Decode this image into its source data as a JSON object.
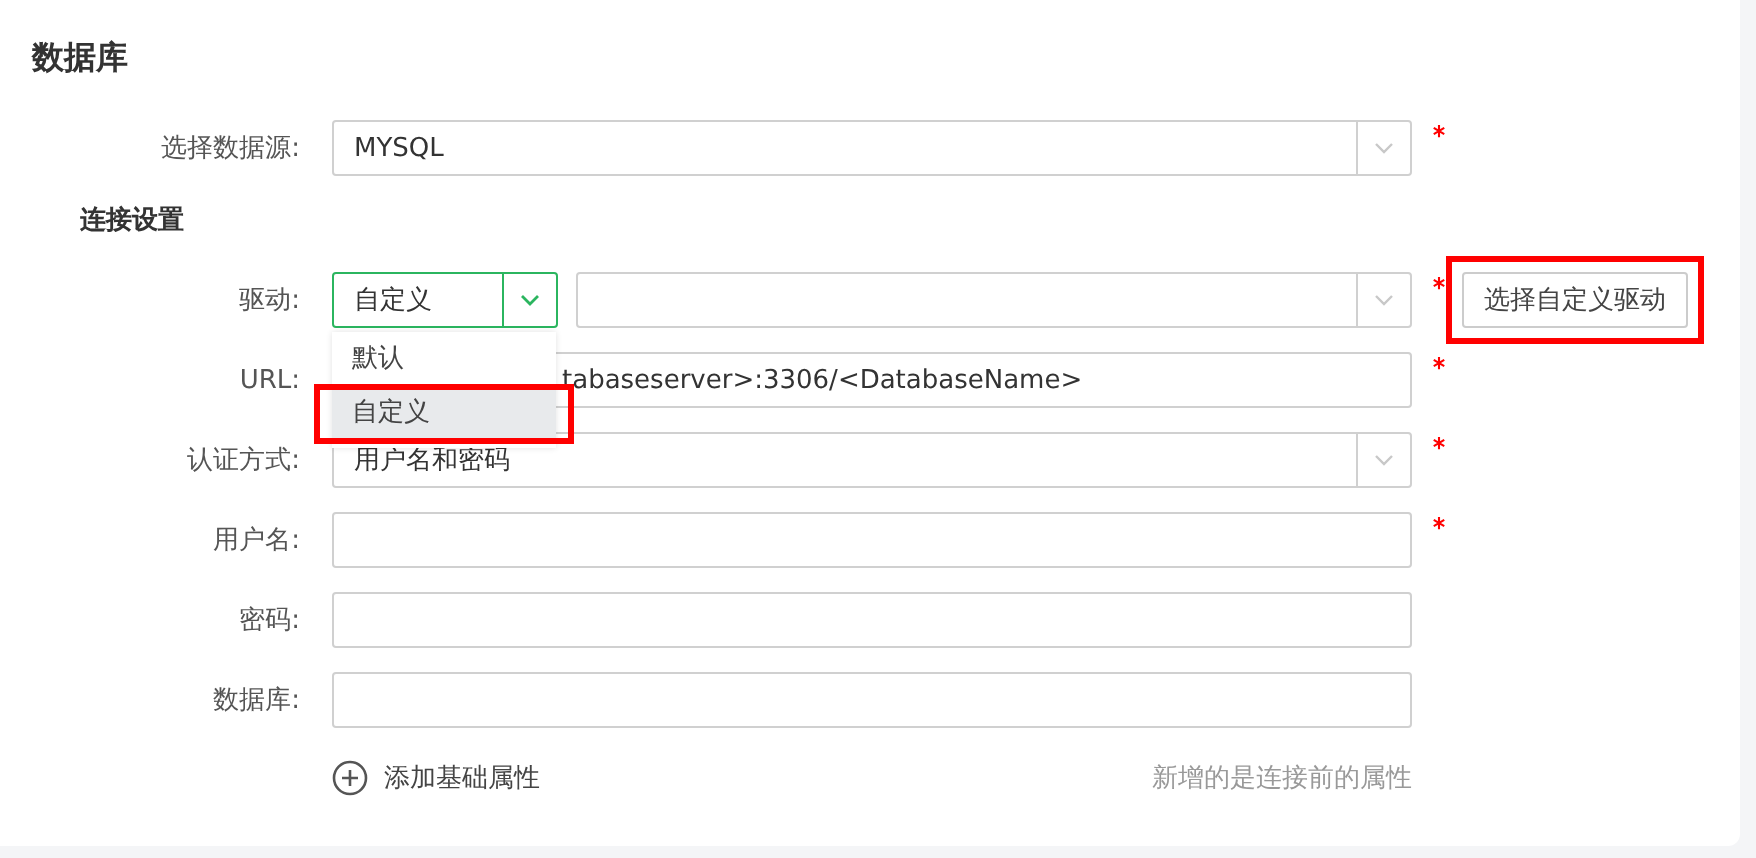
{
  "section_title": "数据库",
  "data_source": {
    "label": "选择数据源:",
    "value": "MYSQL",
    "required": true
  },
  "connection": {
    "title": "连接设置",
    "fields": [
      {
        "kind": "driver",
        "label": "驱动:",
        "value": "自定义",
        "open": true,
        "required": true,
        "button": "选择自定义驱动",
        "button_highlighted": true,
        "options": [
          {
            "label": "默认",
            "selected": false,
            "highlighted": false
          },
          {
            "label": "自定义",
            "selected": true,
            "highlighted": true
          }
        ]
      },
      {
        "kind": "text",
        "label": "URL:",
        "value": "tabaseserver>:3306/<DatabaseName>",
        "required": true
      },
      {
        "kind": "select",
        "label": "认证方式:",
        "value": "用户名和密码",
        "required": true
      },
      {
        "kind": "text",
        "label": "用户名:",
        "required": true
      },
      {
        "kind": "text",
        "label": "密码:",
        "required": false
      },
      {
        "kind": "text",
        "label": "数据库:",
        "required": false
      }
    ]
  },
  "add_property": "添加基础属性",
  "hint": "新增的是连接前的属性"
}
